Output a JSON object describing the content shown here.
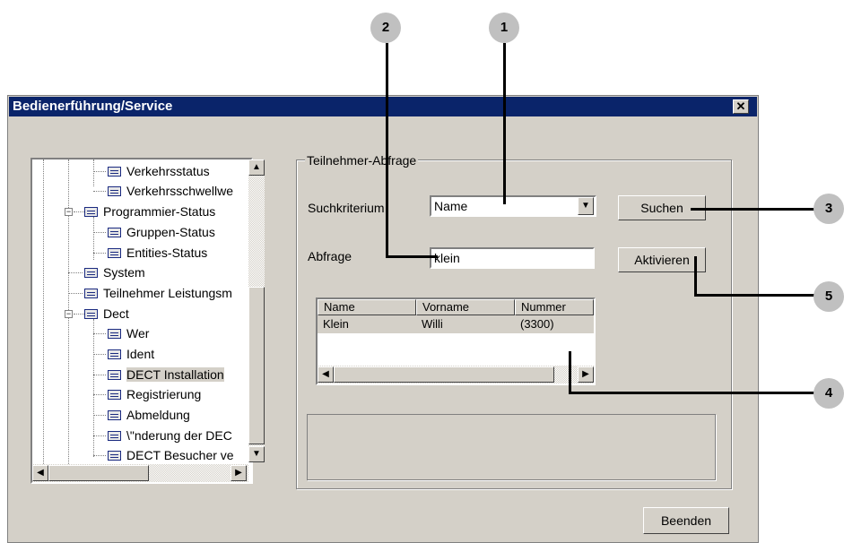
{
  "window": {
    "title": "Bedienerführung/Service",
    "close_glyph": "✕"
  },
  "tree": {
    "items": [
      {
        "label": "Verkehrsstatus"
      },
      {
        "label": "Verkehrsschwellwe"
      },
      {
        "label": "Programmier-Status"
      },
      {
        "label": "Gruppen-Status"
      },
      {
        "label": "Entities-Status"
      },
      {
        "label": "System"
      },
      {
        "label": "Teilnehmer Leistungsm"
      },
      {
        "label": "Dect"
      },
      {
        "label": "Wer"
      },
      {
        "label": "Ident"
      },
      {
        "label": "DECT Installation"
      },
      {
        "label": "Registrierung"
      },
      {
        "label": "Abmeldung"
      },
      {
        "label": "\\\"nderung der DEC"
      },
      {
        "label": "DECT Besucher ve"
      }
    ],
    "selected": "DECT Installation"
  },
  "group": {
    "label": "Teilnehmer-Abfrage"
  },
  "form": {
    "criterion_label": "Suchkriterium",
    "criterion_value": "Name",
    "query_label": "Abfrage",
    "query_value": "klein"
  },
  "buttons": {
    "search": "Suchen",
    "activate": "Aktivieren",
    "close": "Beenden"
  },
  "results": {
    "columns": [
      "Name",
      "Vorname",
      "Nummer"
    ],
    "rows": [
      [
        "Klein",
        "Willi",
        "(3300)"
      ]
    ]
  },
  "callouts": [
    "1",
    "2",
    "3",
    "4",
    "5"
  ],
  "colors": {
    "titlebar": "#0a246a",
    "face": "#d4d0c8",
    "callout": "#c0c0c0"
  }
}
